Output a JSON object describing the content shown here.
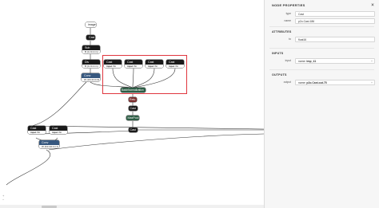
{
  "graph": {
    "nodes": {
      "image": {
        "title": "image"
      },
      "cast_top": {
        "title": "Cast"
      },
      "sub": {
        "title": "Sub",
        "attr": "B  (1×3×1×1)"
      },
      "div": {
        "title": "Div",
        "attr": "B  (1×3×1×1)"
      },
      "conv_top": {
        "title": "Conv",
        "attr": "W  (16×3×3×3)"
      },
      "cast_a": {
        "title": "Cast",
        "port": "input",
        "value": "Wt"
      },
      "cast_b": {
        "title": "Cast",
        "port": "input",
        "value": "Wt"
      },
      "cast_c": {
        "title": "Cast",
        "port": "input",
        "value": "Wt"
      },
      "cast_d": {
        "title": "Cast",
        "port": "input",
        "value": "Wt"
      },
      "batchnorm": {
        "title": "BatchNormalization"
      },
      "relu": {
        "title": "Relu"
      },
      "cast_mid": {
        "title": "Cast"
      },
      "maxpool": {
        "title": "MaxPool"
      },
      "cast_low": {
        "title": "Cast"
      },
      "cast_e": {
        "title": "Cast",
        "port": "input",
        "value": "Wt"
      },
      "cast_f": {
        "title": "Cast",
        "port": "input",
        "value": "Wt"
      },
      "conv_bottom": {
        "title": "Conv",
        "attr": "W  (64×16×1×1)"
      }
    },
    "zoom_controls": [
      "+",
      "−"
    ]
  },
  "panel": {
    "title": "NODE PROPERTIES",
    "close_symbol": "×",
    "node": {
      "type_label": "type",
      "type_value": "Cast",
      "name_label": "name",
      "name_value": "p2o.Cast.186"
    },
    "attributes": {
      "title": "ATTRIBUTES",
      "to_label": "to",
      "to_value": "float16"
    },
    "inputs": {
      "title": "INPUTS",
      "input_label": "input",
      "input_prefix": "name:",
      "input_value": "tmp_41"
    },
    "outputs": {
      "title": "OUTPUTS",
      "output_label": "output",
      "output_prefix": "name:",
      "output_value": "p2o.Cast.out.75"
    }
  },
  "colors": {
    "selection": "#e0363e",
    "node_dark": "#1a1a1a",
    "node_conv": "#37587f",
    "node_maxpool": "#2c5c44",
    "node_relu": "#7a2c2c"
  }
}
